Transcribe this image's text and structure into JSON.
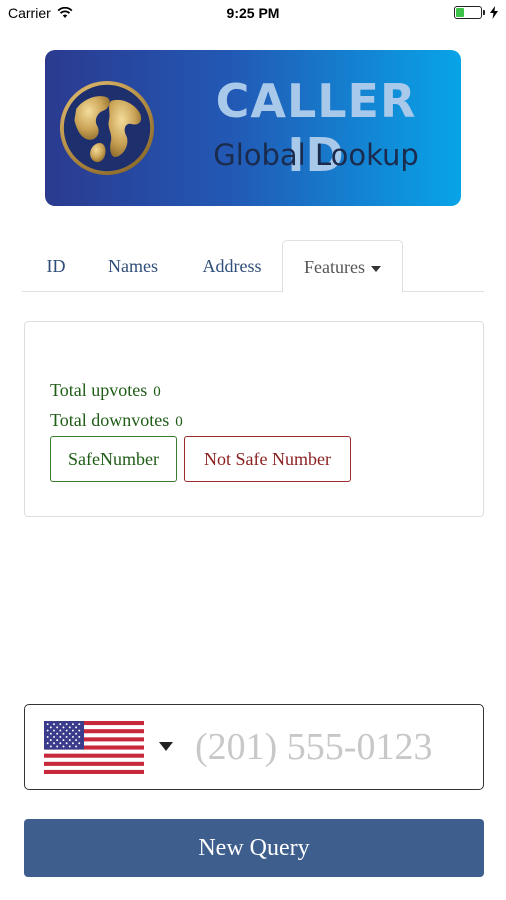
{
  "status_bar": {
    "carrier": "Carrier",
    "time": "9:25 PM",
    "battery_level": 0.3
  },
  "banner": {
    "title": "CALLER ID",
    "subtitle": "Global Lookup",
    "icon": "globe-icon",
    "gradient_start": "#2b3a8f",
    "gradient_end": "#08a4e8"
  },
  "tabs": [
    {
      "label": "ID"
    },
    {
      "label": "Names"
    },
    {
      "label": "Address"
    },
    {
      "label": "Features"
    }
  ],
  "active_tab": "Features",
  "features": {
    "upvotes_label": "Total upvotes",
    "upvotes_count": "0",
    "downvotes_label": "Total downvotes",
    "downvotes_count": "0",
    "safe_button": "SafeNumber",
    "unsafe_button": "Not Safe Number"
  },
  "phone": {
    "country_flag": "us-flag-icon",
    "value": "",
    "placeholder": "(201) 555-0123"
  },
  "query_button": "New Query",
  "colors": {
    "primary": "#3e5f8e",
    "tab_text": "#2e4d79",
    "safe": "#1f5c16",
    "unsafe": "#8b1f1f"
  }
}
